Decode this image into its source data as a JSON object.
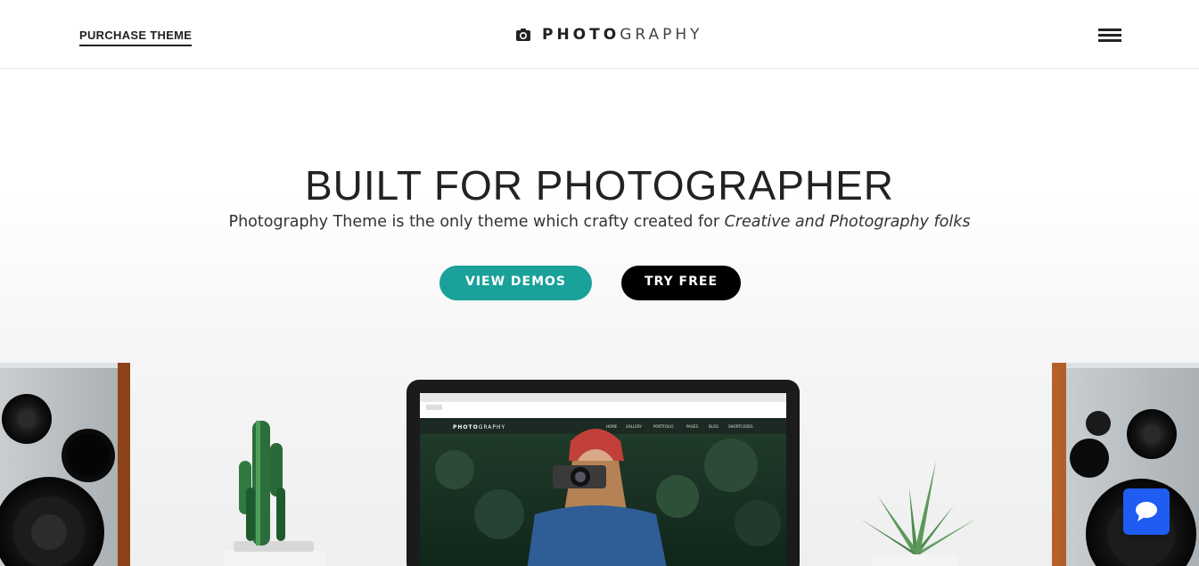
{
  "header": {
    "purchase_label": "PURCHASE THEME",
    "logo_bold": "PHOTO",
    "logo_light": "GRAPHY"
  },
  "hero": {
    "title": "BUILT FOR PHOTOGRAPHER",
    "subtitle_plain": "Photography Theme is the only theme which crafty created for ",
    "subtitle_italic": "Creative and Photography folks",
    "btn_demos": "VIEW DEMOS",
    "btn_try": "TRY FREE"
  },
  "laptop_screen": {
    "logo_bold": "PHOTO",
    "logo_light": "GRAPHY",
    "nav": [
      "HOME",
      "GALLERY",
      "PORTFOLIO",
      "PAGES",
      "BLOG",
      "SHORTCODES"
    ]
  },
  "colors": {
    "accent": "#1aa19a",
    "dark_button": "#000000",
    "chat": "#1f5cf2"
  },
  "icons": {
    "logo": "camera-icon",
    "menu": "hamburger-menu-icon",
    "chat": "chat-bubble-icon"
  }
}
